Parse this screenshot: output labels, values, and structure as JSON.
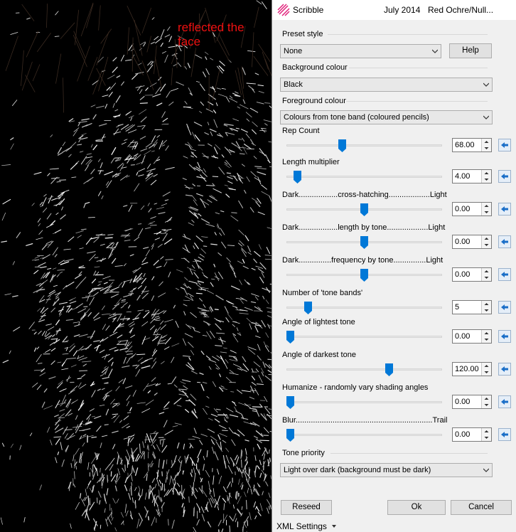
{
  "canvas": {
    "annotation": "reflected the\nface"
  },
  "titlebar": {
    "app_name": "Scribble",
    "date": "July 2014",
    "file": "Red Ochre/Null..."
  },
  "preset": {
    "group_label": "Preset style",
    "value": "None",
    "help_label": "Help"
  },
  "background": {
    "group_label": "Background colour",
    "value": "Black"
  },
  "foreground": {
    "group_label": "Foreground colour",
    "value": "Colours from tone band (coloured pencils)"
  },
  "sliders": [
    {
      "label": "Rep Count",
      "value": "68.00",
      "fraction": 0.35
    },
    {
      "label": "Length multiplier",
      "value": "4.00",
      "fraction": 0.05
    },
    {
      "label": "Dark..................cross-hatching...................Light",
      "value": "0.00",
      "fraction": 0.5
    },
    {
      "label": "Dark..................length by tone...................Light",
      "value": "0.00",
      "fraction": 0.5
    },
    {
      "label": "Dark...............frequency by tone...............Light",
      "value": "0.00",
      "fraction": 0.5
    },
    {
      "label": "Number of 'tone bands'",
      "value": "5",
      "fraction": 0.12
    },
    {
      "label": "Angle of lightest tone",
      "value": "0.00",
      "fraction": 0.0
    },
    {
      "label": "Angle of darkest tone",
      "value": "120.00",
      "fraction": 0.67
    },
    {
      "label": "Humanize - randomly vary shading angles",
      "value": "0.00",
      "fraction": 0.0
    },
    {
      "label": "Blur...............................................................Trail",
      "value": "0.00",
      "fraction": 0.0
    }
  ],
  "tone_priority": {
    "group_label": "Tone priority",
    "value": "Light over dark (background must be dark)"
  },
  "buttons": {
    "reseed": "Reseed",
    "ok": "Ok",
    "cancel": "Cancel"
  },
  "footer": {
    "xml_settings": "XML Settings"
  },
  "colors": {
    "annotation": "#ee1111",
    "thumb": "#0078d7",
    "reset_arrow": "#1b6fc8"
  }
}
